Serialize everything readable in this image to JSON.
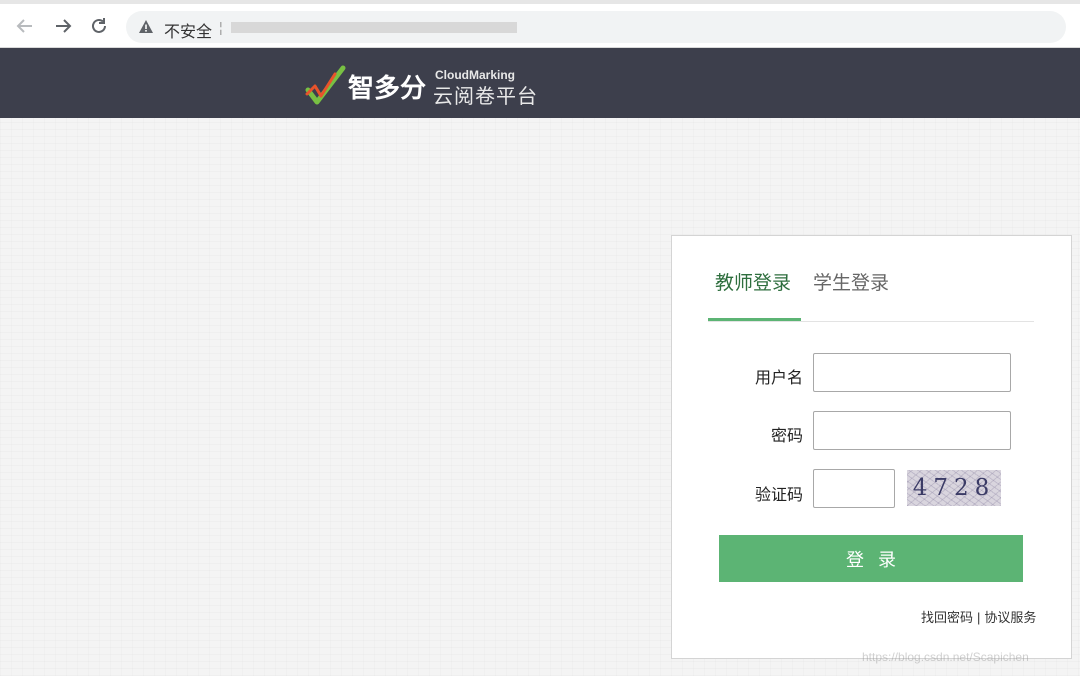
{
  "browser": {
    "security_label": "不安全",
    "separator": "¦"
  },
  "header": {
    "logo_name": "智多分",
    "logo_en": "CloudMarking",
    "logo_cn": "云阅卷平台"
  },
  "login": {
    "tabs": [
      {
        "label": "教师登录",
        "active": true
      },
      {
        "label": "学生登录",
        "active": false
      }
    ],
    "fields": {
      "username_label": "用户名",
      "username_value": "",
      "password_label": "密码",
      "password_value": "",
      "captcha_label": "验证码",
      "captcha_value": "",
      "captcha_image_text": "4728"
    },
    "submit_label": "登录",
    "links": {
      "forgot_password": "找回密码",
      "divider": "|",
      "agreement": "协议服务"
    }
  },
  "watermark": "https://blog.csdn.net/Scapichen",
  "colors": {
    "accent": "#5cb474",
    "header_bg": "#3d3f4c",
    "active_tab": "#2e6e3e"
  }
}
